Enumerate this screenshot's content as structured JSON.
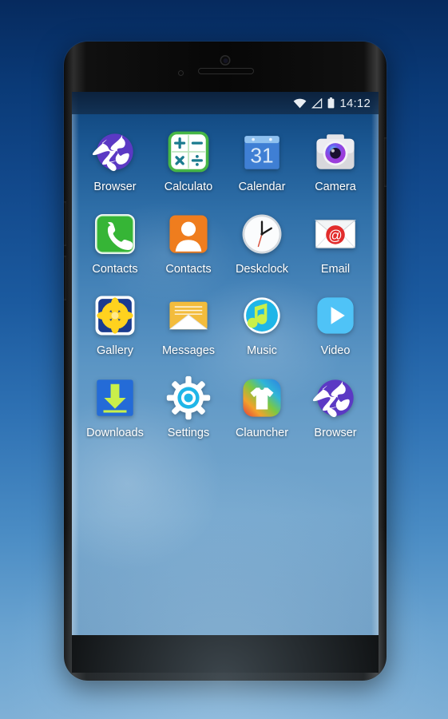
{
  "device": {
    "hardware": {
      "front_camera": "front-camera",
      "proximity_sensor": "proximity-sensor",
      "earpiece": "earpiece-speaker",
      "volume_up": "volume-up-button",
      "volume_down": "volume-down-button",
      "power": "power-button"
    },
    "frame_color": "#0b0b0b",
    "backdrop_colors": [
      "#062a5e",
      "#2f72b4",
      "#7fb0d6"
    ]
  },
  "statusbar": {
    "time": "14:12",
    "icons": [
      "wifi-icon",
      "signal-icon",
      "battery-icon"
    ],
    "background": "#0c203a",
    "foreground": "#e9eef3"
  },
  "apps": [
    {
      "label": "Browser",
      "icon": "browser-globe-icon",
      "color": "#5b39c4"
    },
    {
      "label": "Calculato",
      "icon": "calculator-icon",
      "color": "#46b646"
    },
    {
      "label": "Calendar",
      "icon": "calendar-icon",
      "color": "#3f7fd4"
    },
    {
      "label": "Camera",
      "icon": "camera-icon",
      "color": "#d8d8dc"
    },
    {
      "label": "Contacts",
      "icon": "phone-dialer-icon",
      "color": "#2eaf2e"
    },
    {
      "label": "Contacts",
      "icon": "contacts-person-icon",
      "color": "#ef7d1e"
    },
    {
      "label": "Deskclock",
      "icon": "analog-clock-icon",
      "color": "#f2f2f2"
    },
    {
      "label": "Email",
      "icon": "email-at-icon",
      "color": "#e22c2c"
    },
    {
      "label": "Gallery",
      "icon": "gallery-flower-icon",
      "color": "#ffd21e"
    },
    {
      "label": "Messages",
      "icon": "messages-envelope-icon",
      "color": "#f3bc3c"
    },
    {
      "label": "Music",
      "icon": "music-note-icon",
      "color": "#1fb6e8"
    },
    {
      "label": "Video",
      "icon": "video-play-icon",
      "color": "#4fc3f7"
    },
    {
      "label": "Downloads",
      "icon": "download-arrow-icon",
      "color": "#1e63cf"
    },
    {
      "label": "Settings",
      "icon": "settings-gear-icon",
      "color": "#ffffff"
    },
    {
      "label": "Clauncher",
      "icon": "tshirt-launcher-icon",
      "color": "#59c24a"
    },
    {
      "label": "Browser",
      "icon": "browser-globe-icon",
      "color": "#5b39c4"
    }
  ],
  "calendar_day": "31"
}
